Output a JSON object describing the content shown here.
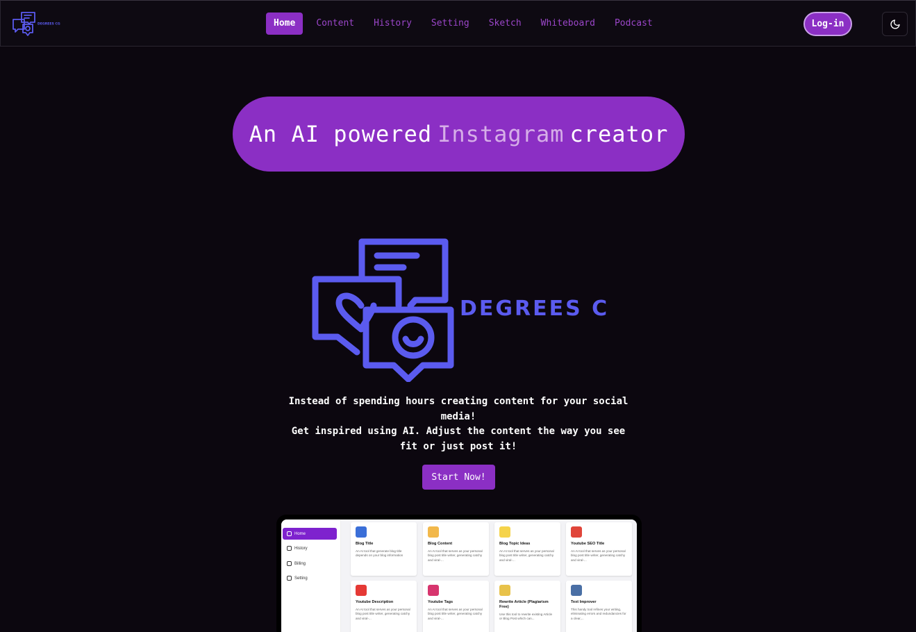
{
  "brand": {
    "name": "DEGREES CG",
    "logo_color": "#5b5bef"
  },
  "nav": {
    "links": [
      "Home",
      "Content",
      "History",
      "Setting",
      "Sketch",
      "Whiteboard",
      "Podcast"
    ],
    "active": "Home",
    "login_label": "Log-in",
    "theme_icon": "moon-icon"
  },
  "hero": {
    "prefix": "An AI powered",
    "accent": "Instagram",
    "suffix": "creator"
  },
  "description": {
    "line1": "Instead of spending hours creating content for your social media!",
    "line2": "Get inspired using AI. Adjust the content the way you see fit or just post it!"
  },
  "cta_label": "Start Now!",
  "preview": {
    "sidebar": [
      "Home",
      "History",
      "Billing",
      "Setting"
    ],
    "cards": [
      {
        "title": "Blog Title",
        "desc": "An AI tool that generate blog title depends on your blog information",
        "icon": "blog-title-icon",
        "color": "#3b6fd8"
      },
      {
        "title": "Blog Content",
        "desc": "An AI tool that serves as your personal blog post title writer, generating catchy and viral-...",
        "icon": "blog-content-icon",
        "color": "#f2b84b"
      },
      {
        "title": "Blog Topic Ideas",
        "desc": "An AI tool that serves as your personal blog post title writer, generating catchy and viral-...",
        "icon": "lightbulb-icon",
        "color": "#f5d34a"
      },
      {
        "title": "Youtube SEO Title",
        "desc": "An AI tool that serves as your personal blog post title writer, generating catchy and viral-...",
        "icon": "seo-icon",
        "color": "#e0453a"
      },
      {
        "title": "Youtube Description",
        "desc": "An AI tool that serves as your personal blog post title writer, generating catchy and viral-...",
        "icon": "youtube-icon",
        "color": "#e53935"
      },
      {
        "title": "Youtube Tags",
        "desc": "An AI tool that serves as your personal blog post title writer, generating catchy and viral-...",
        "icon": "tags-icon",
        "color": "#d7356e"
      },
      {
        "title": "Rewrite Article (Plagiarism Free)",
        "desc": "Use this tool to rewrite existing Article or Blog Post which can...",
        "icon": "rewrite-icon",
        "color": "#e8c24a"
      },
      {
        "title": "Text Improver",
        "desc": "This handy tool refines your writing, eliminating errors and redundancies for a clear,...",
        "icon": "text-improver-icon",
        "color": "#4a6fa5"
      }
    ]
  }
}
